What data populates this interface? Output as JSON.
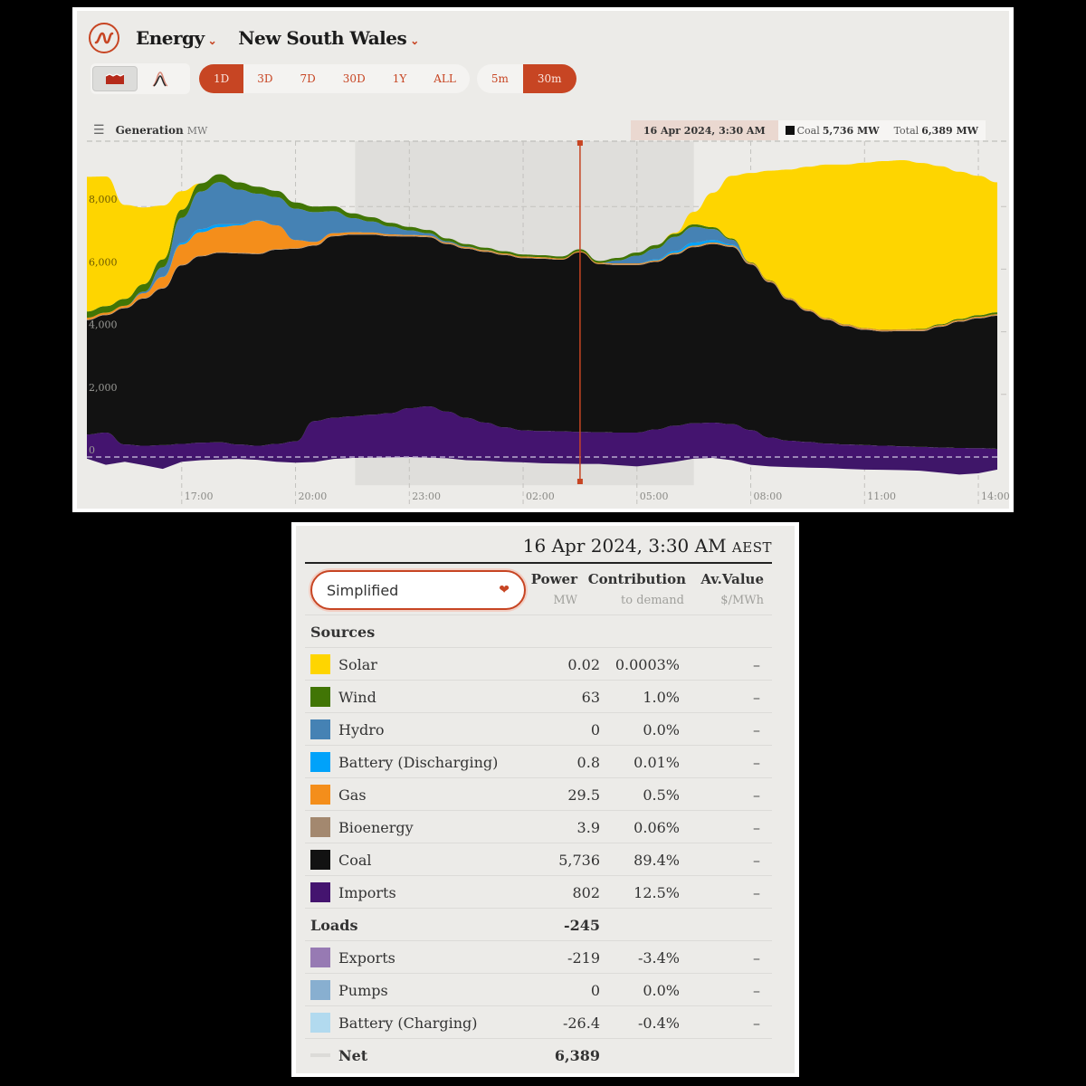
{
  "header": {
    "app_title": "Energy",
    "region": "New South Wales"
  },
  "toolbar": {
    "view_modes": [
      "area-chart-icon",
      "line-chart-icon"
    ],
    "ranges": [
      "1D",
      "3D",
      "7D",
      "30D",
      "1Y",
      "ALL"
    ],
    "active_range": "1D",
    "intervals": [
      "5m",
      "30m"
    ],
    "active_interval": "30m"
  },
  "chart_header": {
    "title": "Generation",
    "unit": "MW"
  },
  "tooltip": {
    "date": "16 Apr 2024, 3:30 AM",
    "series_label": "Coal",
    "series_value": "5,736 MW",
    "total_label": "Total",
    "total_value": "6,389 MW"
  },
  "colors": {
    "accent": "#c74523",
    "solar": "#fed500",
    "wind": "#417505",
    "hydro": "#4582b4",
    "battery_discharging": "#00a2fa",
    "gas": "#f48e1b",
    "bioenergy": "#a3886f",
    "coal": "#121212",
    "imports": "#44146f",
    "exports": "#977ab3",
    "pumps": "#88afd0",
    "battery_charging": "#b2daef"
  },
  "chart_data": {
    "type": "area",
    "title": "Generation MW",
    "xlabel": "",
    "ylabel": "MW",
    "ylim": [
      -800,
      10000
    ],
    "yticks": [
      0,
      2000,
      4000,
      6000,
      8000
    ],
    "ytick_labels": [
      "0",
      "2,000",
      "4,000",
      "6,000",
      "8,000"
    ],
    "xtick_labels": [
      "17:00",
      "20:00",
      "23:00",
      "02:00",
      "05:00",
      "08:00",
      "11:00",
      "14:00"
    ],
    "xtick_index": [
      5,
      11,
      17,
      23,
      29,
      35,
      41,
      47
    ],
    "grid": true,
    "night_shading_index": [
      14,
      32
    ],
    "cursor_index": 26,
    "x": [
      "14:30",
      "15:00",
      "15:30",
      "16:00",
      "16:30",
      "17:00",
      "17:30",
      "18:00",
      "18:30",
      "19:00",
      "19:30",
      "20:00",
      "20:30",
      "21:00",
      "21:30",
      "22:00",
      "22:30",
      "23:00",
      "23:30",
      "00:00",
      "00:30",
      "01:00",
      "01:30",
      "02:00",
      "02:30",
      "03:00",
      "03:30",
      "04:00",
      "04:30",
      "05:00",
      "05:30",
      "06:00",
      "06:30",
      "07:00",
      "07:30",
      "08:00",
      "08:30",
      "09:00",
      "09:30",
      "10:00",
      "10:30",
      "11:00",
      "11:30",
      "12:00",
      "12:30",
      "13:00",
      "13:30",
      "14:00",
      "14:30"
    ],
    "series": [
      {
        "name": "Imports",
        "values": [
          720,
          780,
          400,
          360,
          380,
          420,
          460,
          470,
          400,
          360,
          420,
          500,
          1150,
          1250,
          1300,
          1350,
          1400,
          1560,
          1620,
          1450,
          1250,
          1100,
          950,
          850,
          830,
          820,
          802,
          790,
          780,
          780,
          880,
          1000,
          1080,
          1100,
          1050,
          860,
          620,
          520,
          480,
          430,
          400,
          380,
          360,
          340,
          320,
          300,
          290,
          280,
          260
        ]
      },
      {
        "name": "Coal",
        "values": [
          3650,
          3750,
          4350,
          4700,
          5000,
          5700,
          5950,
          6050,
          6100,
          6120,
          6200,
          6150,
          5600,
          5800,
          5800,
          5750,
          5650,
          5480,
          5400,
          5350,
          5400,
          5450,
          5500,
          5500,
          5500,
          5480,
          5736,
          5370,
          5350,
          5350,
          5350,
          5470,
          5620,
          5700,
          5660,
          5290,
          4960,
          4500,
          4180,
          3950,
          3780,
          3680,
          3650,
          3680,
          3700,
          3860,
          4030,
          4150,
          4250
        ]
      },
      {
        "name": "Bioenergy",
        "values": [
          20,
          20,
          20,
          20,
          20,
          20,
          20,
          20,
          20,
          20,
          20,
          20,
          20,
          20,
          20,
          20,
          20,
          20,
          20,
          20,
          20,
          20,
          20,
          20,
          20,
          10,
          4,
          10,
          20,
          20,
          20,
          20,
          20,
          20,
          20,
          20,
          20,
          20,
          20,
          20,
          20,
          20,
          20,
          20,
          20,
          20,
          20,
          20,
          20
        ]
      },
      {
        "name": "Gas",
        "values": [
          60,
          60,
          60,
          150,
          350,
          650,
          750,
          800,
          880,
          1050,
          760,
          260,
          100,
          80,
          60,
          50,
          40,
          30,
          30,
          30,
          30,
          30,
          30,
          30,
          30,
          30,
          30,
          30,
          30,
          30,
          30,
          30,
          30,
          30,
          30,
          30,
          30,
          30,
          30,
          30,
          30,
          30,
          30,
          30,
          30,
          30,
          30,
          30,
          30
        ]
      },
      {
        "name": "Battery (Discharging)",
        "values": [
          0,
          0,
          0,
          0,
          10,
          50,
          100,
          90,
          40,
          10,
          0,
          0,
          0,
          0,
          0,
          0,
          0,
          0,
          0,
          0,
          0,
          0,
          0,
          0,
          0,
          0,
          1,
          0,
          0,
          0,
          30,
          60,
          100,
          80,
          30,
          0,
          0,
          0,
          0,
          0,
          0,
          0,
          0,
          0,
          0,
          0,
          0,
          0,
          0
        ]
      },
      {
        "name": "Hydro",
        "values": [
          0,
          0,
          0,
          50,
          300,
          800,
          1200,
          1350,
          1100,
          850,
          900,
          1000,
          950,
          700,
          450,
          350,
          250,
          150,
          80,
          40,
          20,
          10,
          0,
          0,
          0,
          0,
          0,
          0,
          100,
          250,
          350,
          450,
          500,
          350,
          150,
          0,
          0,
          0,
          0,
          0,
          0,
          0,
          0,
          0,
          0,
          0,
          0,
          0,
          0
        ]
      },
      {
        "name": "Wind",
        "values": [
          200,
          210,
          220,
          240,
          250,
          260,
          260,
          250,
          230,
          220,
          200,
          200,
          180,
          160,
          150,
          140,
          120,
          110,
          100,
          90,
          80,
          75,
          70,
          68,
          66,
          64,
          63,
          62,
          80,
          100,
          110,
          100,
          80,
          60,
          40,
          20,
          15,
          10,
          10,
          10,
          10,
          10,
          10,
          10,
          20,
          30,
          40,
          50,
          60
        ]
      },
      {
        "name": "Solar",
        "values": [
          4300,
          4140,
          3000,
          2450,
          1720,
          590,
          0,
          0,
          0,
          0,
          0,
          0,
          0,
          0,
          0,
          0,
          0,
          0,
          0,
          0,
          0,
          0,
          0,
          0,
          0,
          0,
          0,
          0,
          0,
          0,
          0,
          30,
          400,
          1100,
          2000,
          2850,
          3500,
          4100,
          4550,
          4900,
          5100,
          5280,
          5380,
          5400,
          5300,
          5050,
          4700,
          4450,
          4150
        ]
      },
      {
        "name": "Exports",
        "values": [
          -50,
          -250,
          -150,
          -260,
          -380,
          -150,
          -100,
          -80,
          -60,
          -90,
          -150,
          -180,
          -160,
          -60,
          -30,
          -20,
          -10,
          0,
          -20,
          -40,
          -100,
          -120,
          -150,
          -170,
          -200,
          -210,
          -219,
          -220,
          -260,
          -300,
          -230,
          -150,
          -50,
          -30,
          -100,
          -250,
          -300,
          -320,
          -340,
          -350,
          -380,
          -400,
          -410,
          -420,
          -440,
          -500,
          -560,
          -520,
          -400
        ]
      }
    ]
  },
  "table": {
    "date": "16 Apr 2024, 3:30 AM",
    "timezone": "AEST",
    "select_value": "Simplified",
    "columns": [
      {
        "title": "Power",
        "sub": "MW"
      },
      {
        "title": "Contribution",
        "sub": "to demand"
      },
      {
        "title": "Av.Value",
        "sub": "$/MWh"
      }
    ],
    "sources_label": "Sources",
    "sources": [
      {
        "name": "Solar",
        "color": "#fed500",
        "power": "0.02",
        "contribution": "0.0003%",
        "value": "–"
      },
      {
        "name": "Wind",
        "color": "#417505",
        "power": "63",
        "contribution": "1.0%",
        "value": "–"
      },
      {
        "name": "Hydro",
        "color": "#4582b4",
        "power": "0",
        "contribution": "0.0%",
        "value": "–"
      },
      {
        "name": "Battery (Discharging)",
        "color": "#00a2fa",
        "power": "0.8",
        "contribution": "0.01%",
        "value": "–"
      },
      {
        "name": "Gas",
        "color": "#f48e1b",
        "power": "29.5",
        "contribution": "0.5%",
        "value": "–"
      },
      {
        "name": "Bioenergy",
        "color": "#a3886f",
        "power": "3.9",
        "contribution": "0.06%",
        "value": "–"
      },
      {
        "name": "Coal",
        "color": "#121212",
        "power": "5,736",
        "contribution": "89.4%",
        "value": "–"
      },
      {
        "name": "Imports",
        "color": "#44146f",
        "power": "802",
        "contribution": "12.5%",
        "value": "–"
      }
    ],
    "loads_label": "Loads",
    "loads_total": "-245",
    "loads": [
      {
        "name": "Exports",
        "color": "#977ab3",
        "power": "-219",
        "contribution": "-3.4%",
        "value": "–"
      },
      {
        "name": "Pumps",
        "color": "#88afd0",
        "power": "0",
        "contribution": "0.0%",
        "value": "–"
      },
      {
        "name": "Battery (Charging)",
        "color": "#b2daef",
        "power": "-26.4",
        "contribution": "-0.4%",
        "value": "–"
      }
    ],
    "net_label": "Net",
    "net_value": "6,389"
  }
}
